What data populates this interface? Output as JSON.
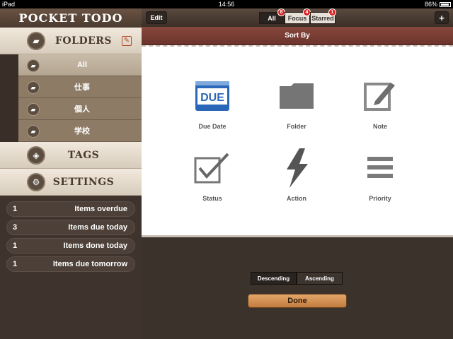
{
  "status_bar": {
    "device": "iPad",
    "time": "14:56",
    "battery": "86%"
  },
  "sidebar": {
    "app_title": "POCKET TODO",
    "folders_label": "FOLDERS",
    "folders": [
      {
        "name": "All",
        "selected": true
      },
      {
        "name": "仕事",
        "selected": false
      },
      {
        "name": "個人",
        "selected": false
      },
      {
        "name": "学校",
        "selected": false
      }
    ],
    "tags_label": "TAGS",
    "settings_label": "SETTINGS",
    "stats": [
      {
        "count": "1",
        "text": "Items overdue"
      },
      {
        "count": "3",
        "text": "Items due today"
      },
      {
        "count": "1",
        "text": "Items done today"
      },
      {
        "count": "1",
        "text": "Items due tomorrow"
      }
    ]
  },
  "topbar": {
    "edit_label": "Edit",
    "add_label": "+",
    "tabs": [
      {
        "label": "All",
        "badge": "8",
        "active": true
      },
      {
        "label": "Focus",
        "badge": "4",
        "active": false
      },
      {
        "label": "Starred",
        "badge": "1",
        "active": false
      }
    ]
  },
  "sort": {
    "title": "Sort By",
    "due_badge": "DUE",
    "options": [
      {
        "label": "Due Date",
        "icon": "due-date-icon"
      },
      {
        "label": "Folder",
        "icon": "folder-icon"
      },
      {
        "label": "Note",
        "icon": "note-icon"
      },
      {
        "label": "Status",
        "icon": "status-checkbox-icon"
      },
      {
        "label": "Action",
        "icon": "lightning-icon"
      },
      {
        "label": "Priority",
        "icon": "priority-bars-icon"
      }
    ],
    "order": {
      "descending": "Descending",
      "ascending": "Ascending"
    },
    "done_label": "Done"
  },
  "colors": {
    "accent": "#6b342c",
    "done_button": "#d48f4f",
    "due_blue": "#2b67b8",
    "badge_red": "#dd2222"
  }
}
